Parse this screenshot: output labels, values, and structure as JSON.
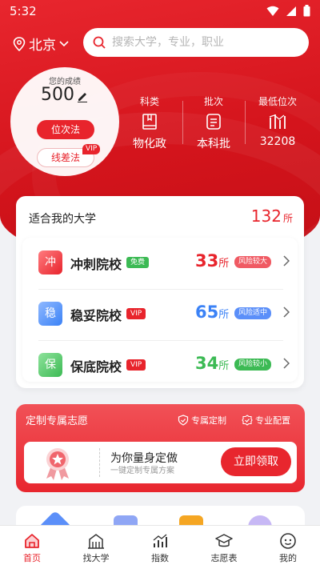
{
  "status_bar": {
    "time": "5:32"
  },
  "header": {
    "city": "北京",
    "search_placeholder": "搜索大学，专业，职业"
  },
  "score_panel": {
    "label": "您的成绩",
    "score": "500",
    "method_primary": "位次法",
    "method_secondary": "线差法",
    "vip_tag": "VIP"
  },
  "stats": [
    {
      "label": "科类",
      "value": "物化政",
      "icon": "book-icon"
    },
    {
      "label": "批次",
      "value": "本科批",
      "icon": "batch-icon"
    },
    {
      "label": "最低位次",
      "value": "32208",
      "icon": "rank-bars-icon"
    }
  ],
  "suitable": {
    "title": "适合我的大学",
    "count": "132",
    "unit": "所",
    "rows": [
      {
        "badge": "冲",
        "name": "冲刺院校",
        "tag": "免费",
        "count": "33",
        "unit": "所",
        "risk": "风险较大",
        "color": "#e8242c",
        "tag_color": "#3cba54",
        "risk_color": "#f05a63"
      },
      {
        "badge": "稳",
        "name": "稳妥院校",
        "tag": "VIP",
        "count": "65",
        "unit": "所",
        "risk": "风险适中",
        "color": "#3b82f6",
        "tag_color": "#e8242c",
        "risk_color": "#5b8ff9"
      },
      {
        "badge": "保",
        "name": "保底院校",
        "tag": "VIP",
        "count": "34",
        "unit": "所",
        "risk": "风险较小",
        "color": "#3cba54",
        "tag_color": "#e8242c",
        "risk_color": "#3cba54"
      }
    ]
  },
  "custom": {
    "title": "定制专属志愿",
    "feature1": "专属定制",
    "feature2": "专业配置",
    "headline": "为你量身定做",
    "subline": "一键定制专属方案",
    "button": "立即领取"
  },
  "tabs": [
    {
      "label": "首页",
      "icon": "home-icon",
      "active": true
    },
    {
      "label": "找大学",
      "icon": "university-icon",
      "active": false
    },
    {
      "label": "指数",
      "icon": "index-chart-icon",
      "active": false
    },
    {
      "label": "志愿表",
      "icon": "graduation-cap-icon",
      "active": false
    },
    {
      "label": "我的",
      "icon": "profile-face-icon",
      "active": false
    }
  ],
  "colors": {
    "brand": "#e8242c",
    "background": "#f1f2f5"
  }
}
